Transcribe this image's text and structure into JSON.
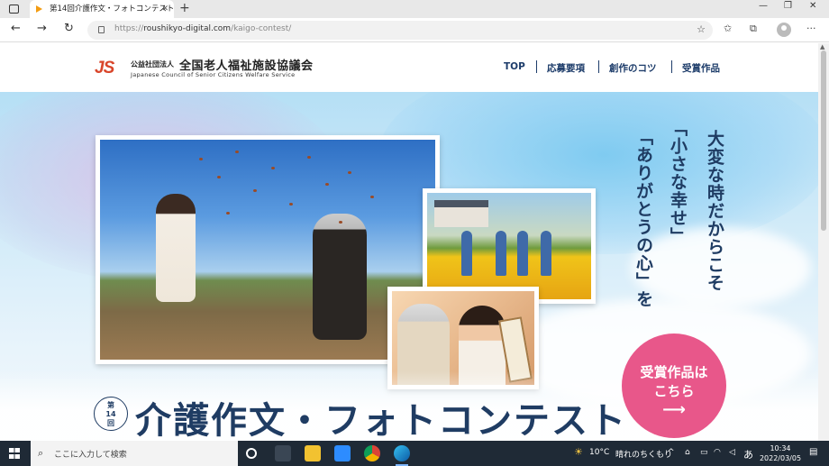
{
  "browser": {
    "tab_title": "第14回介護作文・フォトコンテスト",
    "tab_close": "✕",
    "new_tab": "+",
    "url_prefix": "https://",
    "url_host": "roushikyo-digital.com",
    "url_path": "/kaigo-contest/"
  },
  "site": {
    "logo_mark": "JS",
    "org_prefix": "公益社団法人",
    "org_name": "全国老人福祉施設協議会",
    "org_english": "Japanese Council of Senior Citizens Welfare Service",
    "menu": [
      "TOP",
      "応募要項",
      "創作のコツ",
      "受賞作品"
    ]
  },
  "hero": {
    "catch_lines": [
      "大変な時だからこそ",
      "「小さな幸せ」",
      "「ありがとうの心」を"
    ],
    "badge_line1": "受賞作品は",
    "badge_line2": "こちら",
    "badge_arrow": "⟶",
    "edition_line1": "第",
    "edition_line2": "14",
    "edition_line3": "回",
    "contest_title": "介護作文・フォトコンテスト"
  },
  "taskbar": {
    "search_placeholder": "ここに入力して検索",
    "temperature": "10°C",
    "weather": "晴れのちくもり",
    "ime": "あ",
    "time": "10:34",
    "date": "2022/03/05"
  }
}
